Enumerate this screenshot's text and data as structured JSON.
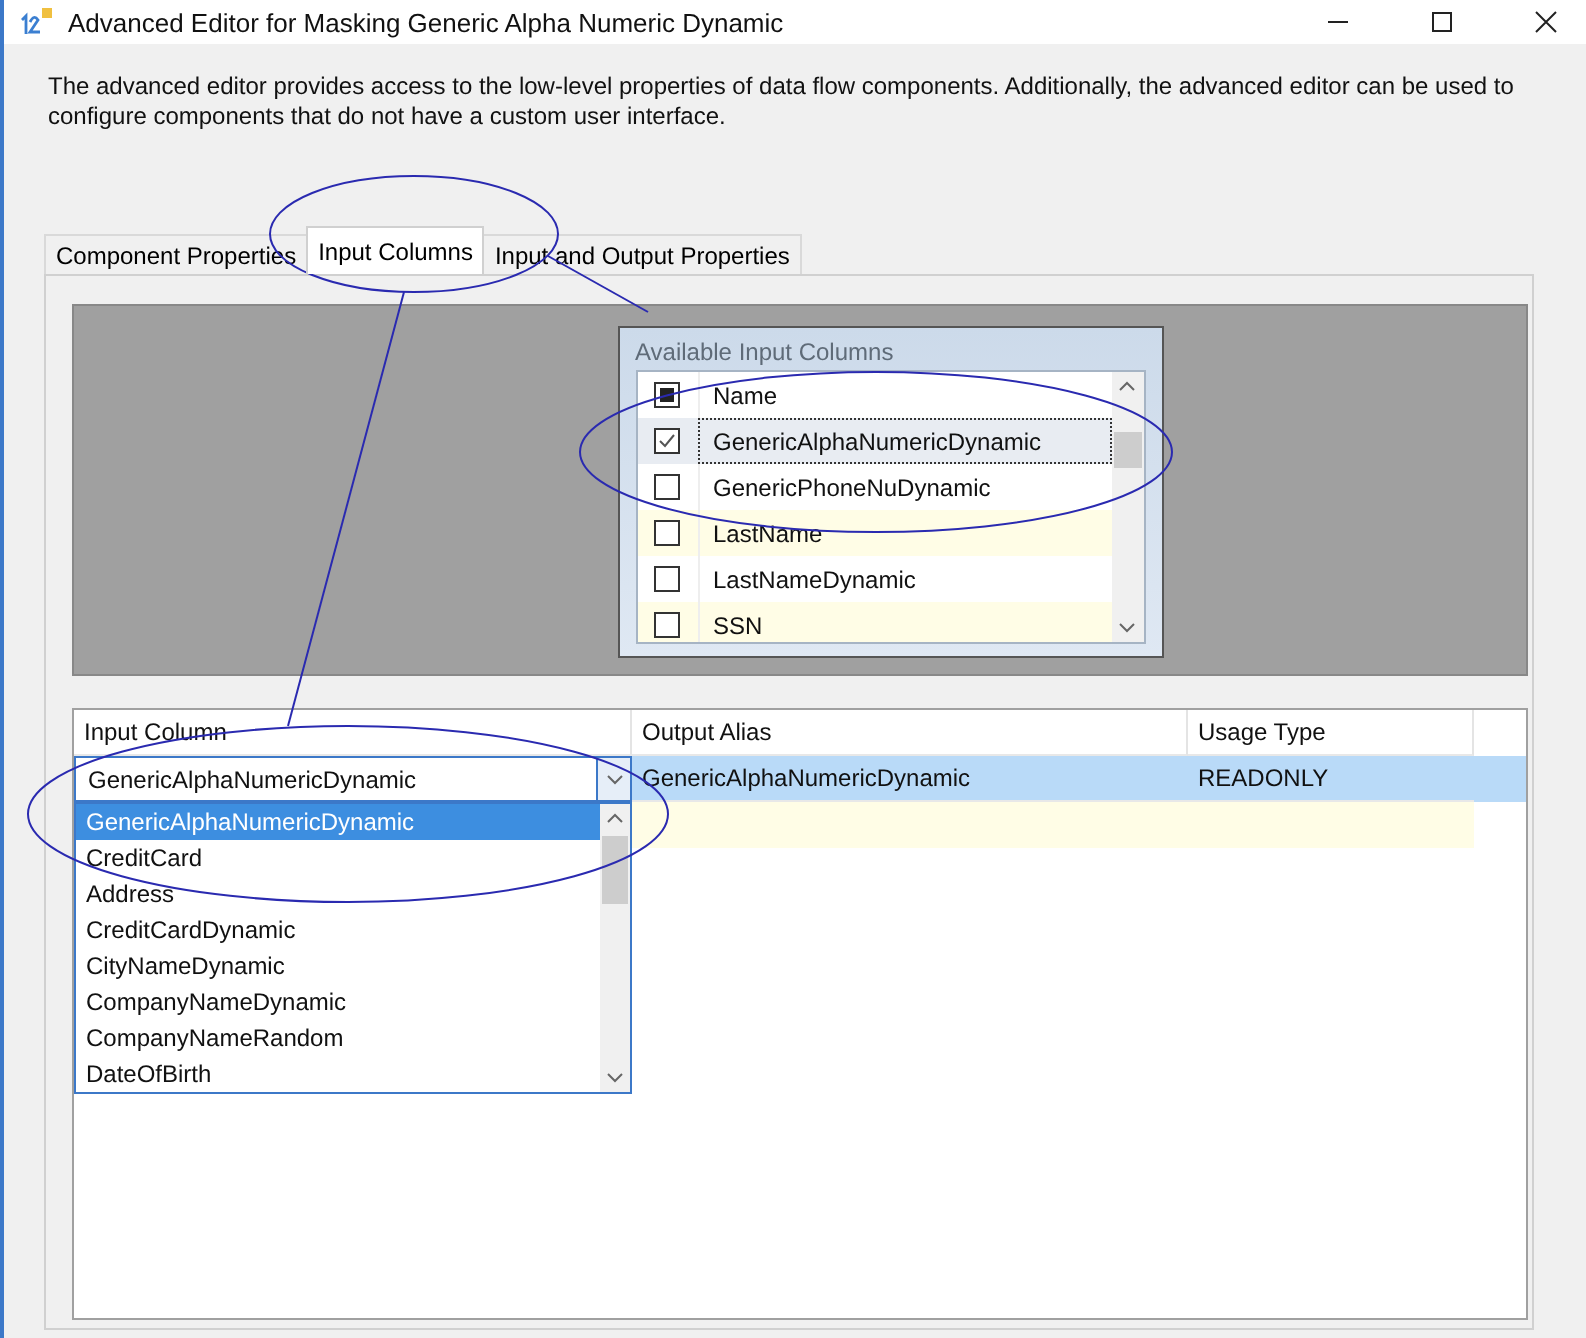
{
  "window": {
    "title": "Advanced Editor for Masking Generic Alpha Numeric Dynamic"
  },
  "description": "The advanced editor provides access to the low-level properties of data flow components. Additionally, the advanced editor can be used to configure components that do not have a custom user interface.",
  "tabs": [
    {
      "label": "Component Properties",
      "selected": false
    },
    {
      "label": "Input Columns",
      "selected": true
    },
    {
      "label": "Input and Output Properties",
      "selected": false
    }
  ],
  "available_input_columns": {
    "title": "Available Input Columns",
    "header": {
      "label": "Name",
      "indeterminate": true
    },
    "rows": [
      {
        "name": "GenericAlphaNumericDynamic",
        "checked": true,
        "selected": true
      },
      {
        "name": "GenericPhoneNuDynamic",
        "checked": false,
        "selected": false
      },
      {
        "name": "LastName",
        "checked": false,
        "selected": false
      },
      {
        "name": "LastNameDynamic",
        "checked": false,
        "selected": false
      },
      {
        "name": "SSN",
        "checked": false,
        "selected": false
      }
    ]
  },
  "mapping_grid": {
    "columns": [
      "Input Column",
      "Output Alias",
      "Usage Type"
    ],
    "rows": [
      {
        "cells": [
          "GenericAlphaNumericDynamic",
          "GenericAlphaNumericDynamic",
          "READONLY"
        ],
        "selected": true
      }
    ],
    "new_row": true,
    "dropdown": {
      "options": [
        {
          "label": "GenericAlphaNumericDynamic",
          "selected": true
        },
        {
          "label": "CreditCard",
          "selected": false
        },
        {
          "label": "Address",
          "selected": false
        },
        {
          "label": "CreditCardDynamic",
          "selected": false
        },
        {
          "label": "CityNameDynamic",
          "selected": false
        },
        {
          "label": "CompanyNameDynamic",
          "selected": false
        },
        {
          "label": "CompanyNameRandom",
          "selected": false
        },
        {
          "label": "DateOfBirth",
          "selected": false
        }
      ]
    }
  }
}
